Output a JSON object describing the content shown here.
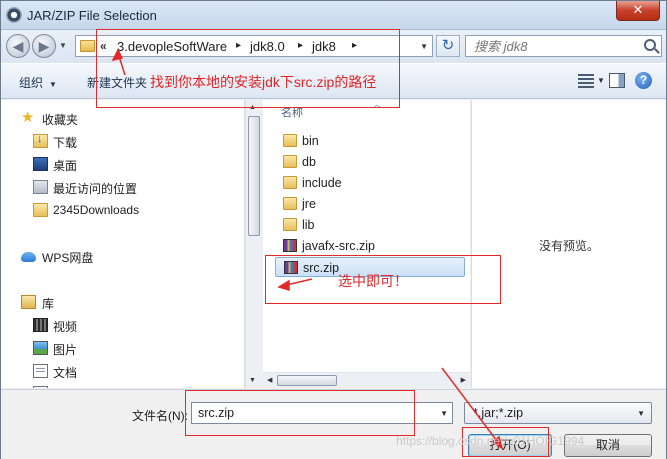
{
  "window": {
    "title": "JAR/ZIP File Selection",
    "close_glyph": "✕"
  },
  "nav": {
    "back_glyph": "◀",
    "forward_glyph": "▶",
    "breadcrumb_chevron": "«",
    "breadcrumb": [
      "3.devopleSoftWare",
      "jdk8.0",
      "jdk8"
    ],
    "separator_glyph": "▸",
    "refresh_glyph": "↻",
    "search_placeholder": "搜索 jdk8"
  },
  "toolbar": {
    "organize_label": "组织",
    "new_folder_label": "新建文件夹",
    "help_glyph": "?"
  },
  "sidebar": {
    "favorites": {
      "label": "收藏夹",
      "items": [
        {
          "label": "下载",
          "icon": "download-icon"
        },
        {
          "label": "桌面",
          "icon": "desktop-icon"
        },
        {
          "label": "最近访问的位置",
          "icon": "recent-places-icon"
        },
        {
          "label": "2345Downloads",
          "icon": "folder-icon"
        }
      ]
    },
    "cloud": {
      "label": "WPS网盘",
      "icon": "cloud-icon"
    },
    "libraries": {
      "label": "库",
      "items": [
        {
          "label": "视频",
          "icon": "video-icon"
        },
        {
          "label": "图片",
          "icon": "picture-icon"
        },
        {
          "label": "文档",
          "icon": "document-icon"
        }
      ]
    }
  },
  "filelist": {
    "column_header": "名称",
    "files": [
      {
        "name": "bin",
        "icon": "folder-icon",
        "selected": false
      },
      {
        "name": "db",
        "icon": "folder-icon",
        "selected": false
      },
      {
        "name": "include",
        "icon": "folder-icon",
        "selected": false
      },
      {
        "name": "jre",
        "icon": "folder-icon",
        "selected": false
      },
      {
        "name": "lib",
        "icon": "folder-icon",
        "selected": false
      },
      {
        "name": "javafx-src.zip",
        "icon": "zip-archive-icon",
        "selected": false
      },
      {
        "name": "src.zip",
        "icon": "zip-archive-icon",
        "selected": true
      }
    ]
  },
  "preview": {
    "text": "没有预览。"
  },
  "bottom": {
    "filename_label": "文件名(N):",
    "filename_value": "src.zip",
    "filetype_value": "*.jar;*.zip",
    "open_label": "打开(O)",
    "cancel_label": "取消"
  },
  "annotations": {
    "address_note": "找到你本地的安装jdk下src.zip的路径",
    "select_note": "选中即可！",
    "color": "#e02b2b"
  },
  "watermark": "https://blog.csdn.net/u01HOIG1994"
}
